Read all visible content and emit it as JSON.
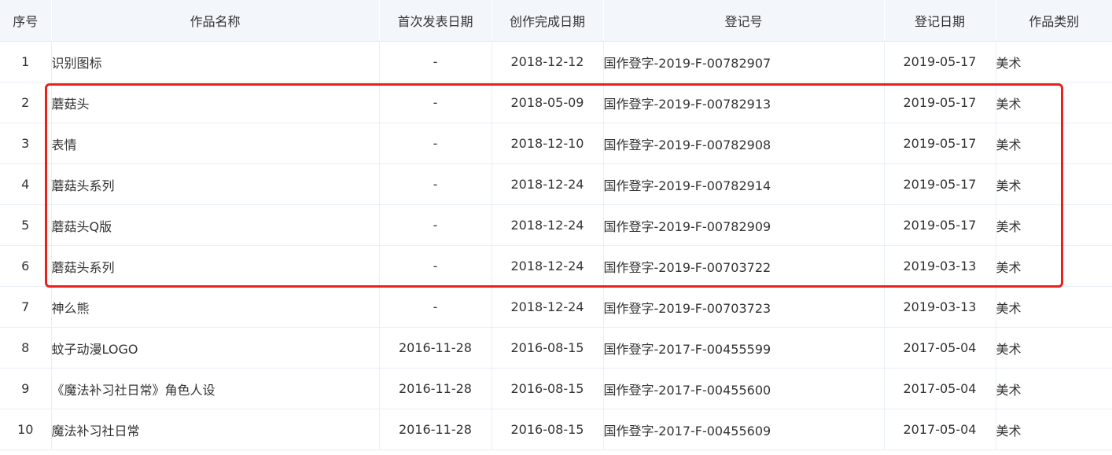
{
  "table": {
    "headers": {
      "index": "序号",
      "name": "作品名称",
      "first_pub": "首次发表日期",
      "completed": "创作完成日期",
      "reg_no": "登记号",
      "reg_date": "登记日期",
      "category": "作品类别"
    },
    "rows": [
      {
        "index": "1",
        "name": "识别图标",
        "first_pub": "-",
        "completed": "2018-12-12",
        "reg_no": "国作登字-2019-F-00782907",
        "reg_date": "2019-05-17",
        "category": "美术"
      },
      {
        "index": "2",
        "name": "蘑菇头",
        "first_pub": "-",
        "completed": "2018-05-09",
        "reg_no": "国作登字-2019-F-00782913",
        "reg_date": "2019-05-17",
        "category": "美术"
      },
      {
        "index": "3",
        "name": "表情",
        "first_pub": "-",
        "completed": "2018-12-10",
        "reg_no": "国作登字-2019-F-00782908",
        "reg_date": "2019-05-17",
        "category": "美术"
      },
      {
        "index": "4",
        "name": "蘑菇头系列",
        "first_pub": "-",
        "completed": "2018-12-24",
        "reg_no": "国作登字-2019-F-00782914",
        "reg_date": "2019-05-17",
        "category": "美术"
      },
      {
        "index": "5",
        "name": "蘑菇头Q版",
        "first_pub": "-",
        "completed": "2018-12-24",
        "reg_no": "国作登字-2019-F-00782909",
        "reg_date": "2019-05-17",
        "category": "美术"
      },
      {
        "index": "6",
        "name": "蘑菇头系列",
        "first_pub": "-",
        "completed": "2018-12-24",
        "reg_no": "国作登字-2019-F-00703722",
        "reg_date": "2019-03-13",
        "category": "美术"
      },
      {
        "index": "7",
        "name": "神么熊",
        "first_pub": "-",
        "completed": "2018-12-24",
        "reg_no": "国作登字-2019-F-00703723",
        "reg_date": "2019-03-13",
        "category": "美术"
      },
      {
        "index": "8",
        "name": "蚊子动漫LOGO",
        "first_pub": "2016-11-28",
        "completed": "2016-08-15",
        "reg_no": "国作登字-2017-F-00455599",
        "reg_date": "2017-05-04",
        "category": "美术"
      },
      {
        "index": "9",
        "name": "《魔法补习社日常》角色人设",
        "first_pub": "2016-11-28",
        "completed": "2016-08-15",
        "reg_no": "国作登字-2017-F-00455600",
        "reg_date": "2017-05-04",
        "category": "美术"
      },
      {
        "index": "10",
        "name": "魔法补习社日常",
        "first_pub": "2016-11-28",
        "completed": "2016-08-15",
        "reg_no": "国作登字-2017-F-00455609",
        "reg_date": "2017-05-04",
        "category": "美术"
      }
    ]
  },
  "colors": {
    "header_bg": "#f3f6fb",
    "border": "#e8eef6",
    "highlight": "#e8221b"
  }
}
